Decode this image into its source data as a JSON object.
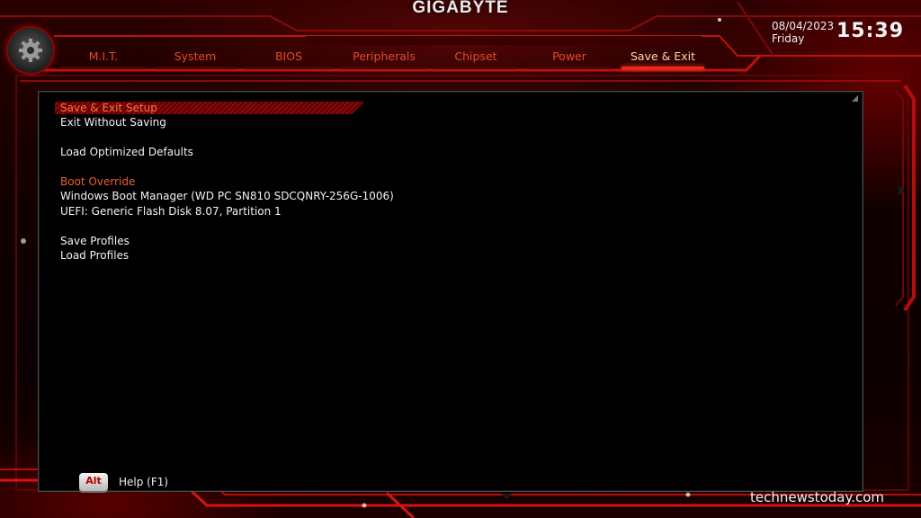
{
  "brand": "GIGABYTE",
  "datetime": {
    "date": "08/04/2023",
    "day": "Friday",
    "time": "15:39"
  },
  "tabs": [
    {
      "label": "M.I.T.",
      "active": false
    },
    {
      "label": "System",
      "active": false
    },
    {
      "label": "BIOS",
      "active": false
    },
    {
      "label": "Peripherals",
      "active": false
    },
    {
      "label": "Chipset",
      "active": false
    },
    {
      "label": "Power",
      "active": false
    },
    {
      "label": "Save & Exit",
      "active": true
    }
  ],
  "menu": {
    "save_exit_setup": "Save & Exit Setup",
    "exit_without_saving": "Exit Without Saving",
    "load_optimized_defaults": "Load Optimized Defaults",
    "boot_override_header": "Boot Override",
    "boot_option_1": "Windows Boot Manager (WD PC SN810 SDCQNRY-256G-1006)",
    "boot_option_2": "UEFI: Generic Flash Disk 8.07, Partition 1",
    "save_profiles": "Save Profiles",
    "load_profiles": "Load Profiles"
  },
  "help": {
    "key": "Alt",
    "label": "Help (F1)"
  },
  "watermark": "technewstoday.com",
  "colors": {
    "accent_red": "#e14a2e",
    "selected_orange": "#ff7240",
    "panel_bg": "#000000",
    "frame_red": "#b30d0d"
  },
  "icons": {
    "gear": "gear-icon",
    "alt_key": "alt-key-icon"
  }
}
